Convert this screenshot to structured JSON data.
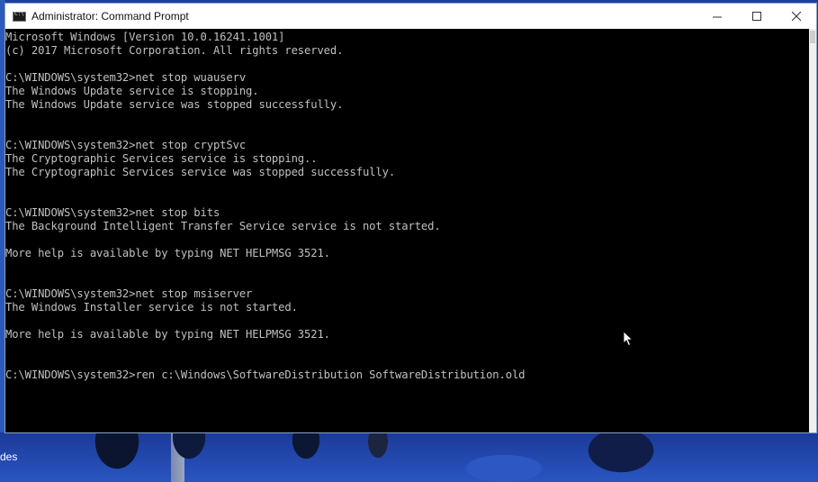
{
  "window": {
    "title": "Administrator: Command Prompt",
    "icon": "cmd-icon",
    "controls": {
      "minimize": "minimize-icon",
      "maximize": "maximize-icon",
      "close": "close-icon"
    }
  },
  "console": {
    "lines": [
      "Microsoft Windows [Version 10.0.16241.1001]",
      "(c) 2017 Microsoft Corporation. All rights reserved.",
      "",
      "C:\\WINDOWS\\system32>net stop wuauserv",
      "The Windows Update service is stopping.",
      "The Windows Update service was stopped successfully.",
      "",
      "",
      "C:\\WINDOWS\\system32>net stop cryptSvc",
      "The Cryptographic Services service is stopping..",
      "The Cryptographic Services service was stopped successfully.",
      "",
      "",
      "C:\\WINDOWS\\system32>net stop bits",
      "The Background Intelligent Transfer Service service is not started.",
      "",
      "More help is available by typing NET HELPMSG 3521.",
      "",
      "",
      "C:\\WINDOWS\\system32>net stop msiserver",
      "The Windows Installer service is not started.",
      "",
      "More help is available by typing NET HELPMSG 3521.",
      "",
      "",
      "C:\\WINDOWS\\system32>ren c:\\Windows\\SoftwareDistribution SoftwareDistribution.old"
    ]
  },
  "desktop": {
    "partial_label": "des"
  }
}
